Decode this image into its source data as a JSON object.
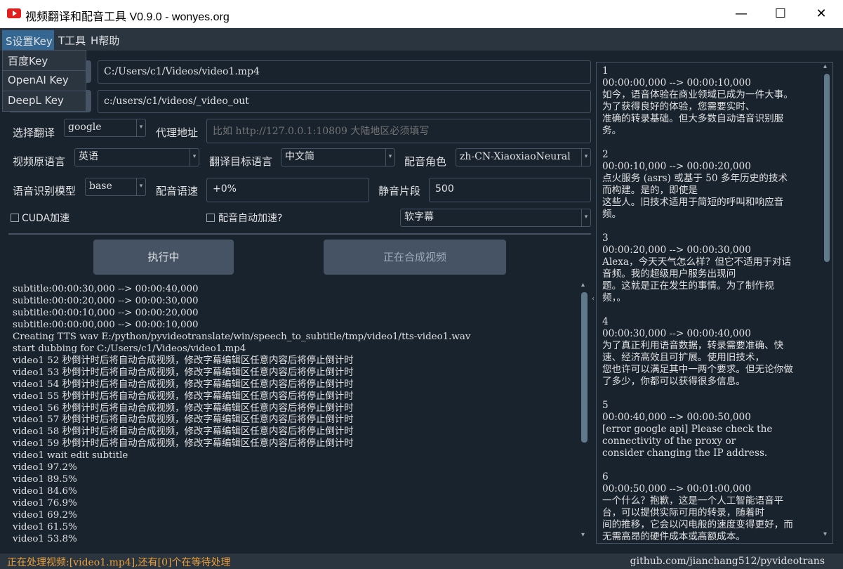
{
  "window": {
    "title": "视频翻译和配音工具 V0.9.0 - wonyes.org",
    "minimize": "—",
    "maximize": "☐",
    "close": "✕"
  },
  "menu": {
    "settings": "S设置Key",
    "tools": "T工具",
    "help": "H帮助",
    "dropdown": [
      "百度Key",
      "OpenAI Key",
      "DeepL Key"
    ]
  },
  "form": {
    "source_path": "C:/Users/c1/Videos/video1.mp4",
    "output_path": "c:/users/c1/videos/_video_out",
    "translate_label": "选择翻译",
    "translate_value": "google",
    "proxy_label": "代理地址",
    "proxy_placeholder": "比如 http://127.0.0.1:10809 大陆地区必须填写",
    "source_lang_label": "视频原语言",
    "source_lang_value": "英语",
    "target_lang_label": "翻译目标语言",
    "target_lang_value": "中文简",
    "voice_label": "配音角色",
    "voice_value": "zh-CN-XiaoxiaoNeural",
    "model_label": "语音识别模型",
    "model_value": "base",
    "speed_label": "配音语速",
    "speed_value": "+0%",
    "silence_label": "静音片段",
    "silence_value": "500",
    "cuda_label": "CUDA加速",
    "auto_speed_label": "配音自动加速?",
    "subtitle_type": "软字幕"
  },
  "buttons": {
    "run": "执行中",
    "compose": "正在合成视频"
  },
  "log": "subtitle:00:00:30,000 --> 00:00:40,000\nsubtitle:00:00:20,000 --> 00:00:30,000\nsubtitle:00:00:10,000 --> 00:00:20,000\nsubtitle:00:00:00,000 --> 00:00:10,000\nCreating TTS wav E:/python/pyvideotranslate/win/speech_to_subtitle/tmp/video1/tts-video1.wav\nstart dubbing for C:/Users/c1/Videos/video1.mp4\nvideo1 52 秒倒计时后将自动合成视频，修改字幕编辑区任意内容后将停止倒计时\nvideo1 53 秒倒计时后将自动合成视频，修改字幕编辑区任意内容后将停止倒计时\nvideo1 54 秒倒计时后将自动合成视频，修改字幕编辑区任意内容后将停止倒计时\nvideo1 55 秒倒计时后将自动合成视频，修改字幕编辑区任意内容后将停止倒计时\nvideo1 56 秒倒计时后将自动合成视频，修改字幕编辑区任意内容后将停止倒计时\nvideo1 57 秒倒计时后将自动合成视频，修改字幕编辑区任意内容后将停止倒计时\nvideo1 58 秒倒计时后将自动合成视频，修改字幕编辑区任意内容后将停止倒计时\nvideo1 59 秒倒计时后将自动合成视频，修改字幕编辑区任意内容后将停止倒计时\nvideo1 wait edit subtitle\nvideo1 97.2%\nvideo1 89.5%\nvideo1 84.6%\nvideo1 76.9%\nvideo1 69.2%\nvideo1 61.5%\nvideo1 53.8%",
  "subtitles": "1\n00:00:00,000 --> 00:00:10,000\n如今，语音体验在商业领域已成为一件大事。\n为了获得良好的体验，您需要实时、\n准确的转录基础。但大多数自动语音识别服\n务。\n\n2\n00:00:10,000 --> 00:00:20,000\n点火服务 (asrs) 或基于 50 多年历史的技术\n而构建。是的，即使是\n这些人。旧技术适用于简短的呼叫和响应音\n频。\n\n3\n00:00:20,000 --> 00:00:30,000\nAlexa，今天天气怎么样？但它不适用于对话\n音频。我的超级用户服务出现问\n题。这就是正在发生的事情。为了制作视\n频，。\n\n4\n00:00:30,000 --> 00:00:40,000\n为了真正利用语音数据，转录需要准确、快\n速、经济高效且可扩展。使用旧技术，\n您也许可以满足其中一两个要求。但无论你做\n了多少，你都可以获得很多信息。\n\n5\n00:00:40,000 --> 00:00:50,000\n[error google api] Please check the\nconnectivity of the proxy or\nconsider changing the IP address.\n\n6\n00:00:50,000 --> 00:01:00,000\n一个什么？抱歉，这是一个人工智能语音平\n台，可以提供实际可用的转录，随着时\n间的推移，它会以闪电般的速度变得更好，而\n无需高昂的硬件成本或高额成本。",
  "status": {
    "left": "正在处理视频:[video1.mp4],还有[0]个在等待处理",
    "right": "github.com/jianchang512/pyvideotrans"
  },
  "icons": {
    "app": "youtube-play-icon",
    "arrow_down": "▾",
    "arrow_up": "▴",
    "splitter": "‹"
  },
  "colors": {
    "background": "#19232d",
    "menu_highlight": "#346792",
    "status_text": "#e9a03b"
  }
}
